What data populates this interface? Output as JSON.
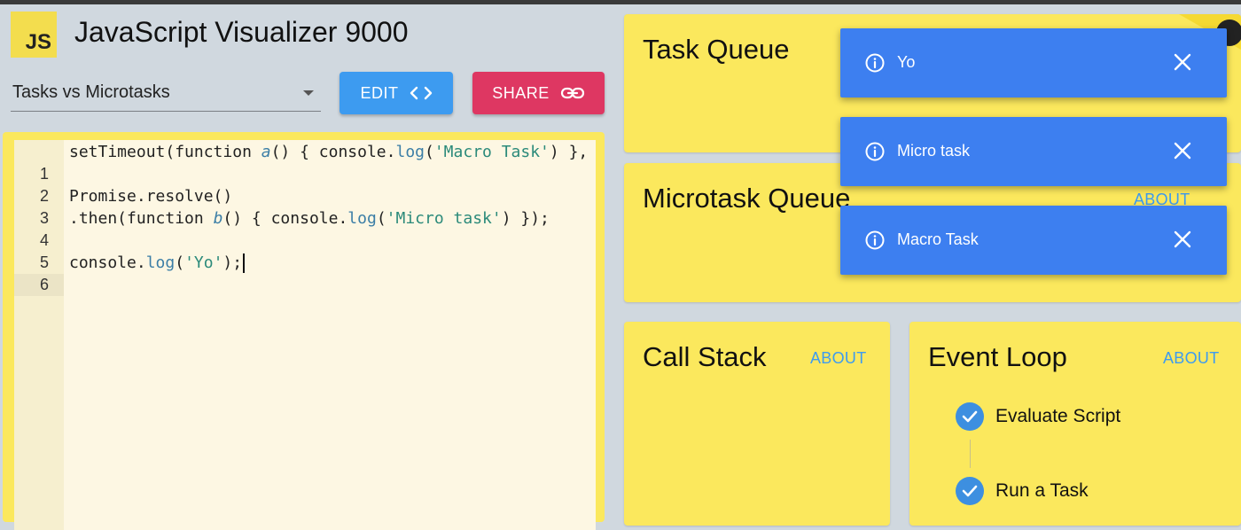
{
  "app": {
    "logo": "JS",
    "title": "JavaScript Visualizer 9000"
  },
  "example_select": {
    "value": "Tasks vs Microtasks"
  },
  "buttons": {
    "edit": "EDIT",
    "share": "SHARE"
  },
  "editor": {
    "lines": [
      {
        "num": "1",
        "text": "setTimeout(function a() { console.log('Macro Task') },"
      },
      {
        "num": "2",
        "text": ""
      },
      {
        "num": "3",
        "text": "Promise.resolve()"
      },
      {
        "num": "4",
        "text": ".then(function b() { console.log('Micro task') });"
      },
      {
        "num": "5",
        "text": ""
      },
      {
        "num": "6",
        "text": "console.log('Yo');"
      }
    ],
    "active_line": "6"
  },
  "panels": {
    "task_queue": {
      "title": "Task Queue"
    },
    "microtask_queue": {
      "title": "Microtask Queue",
      "about": "ABOUT"
    },
    "call_stack": {
      "title": "Call Stack",
      "about": "ABOUT"
    },
    "event_loop": {
      "title": "Event Loop",
      "about": "ABOUT",
      "steps": [
        {
          "label": "Evaluate Script",
          "state": "done"
        },
        {
          "label": "Run a Task",
          "state": "done"
        }
      ]
    }
  },
  "toasts": [
    {
      "message": "Yo",
      "icon": "info-icon"
    },
    {
      "message": "Micro task",
      "icon": "info-icon"
    },
    {
      "message": "Macro Task",
      "icon": "info-icon"
    }
  ],
  "colors": {
    "background": "#d0d8df",
    "panel": "#fbe85d",
    "edit_button": "#3d9bf0",
    "share_button": "#de3762",
    "toast": "#3d7ff0",
    "about_link": "#3d9bf0",
    "check": "#3d8fe0"
  }
}
